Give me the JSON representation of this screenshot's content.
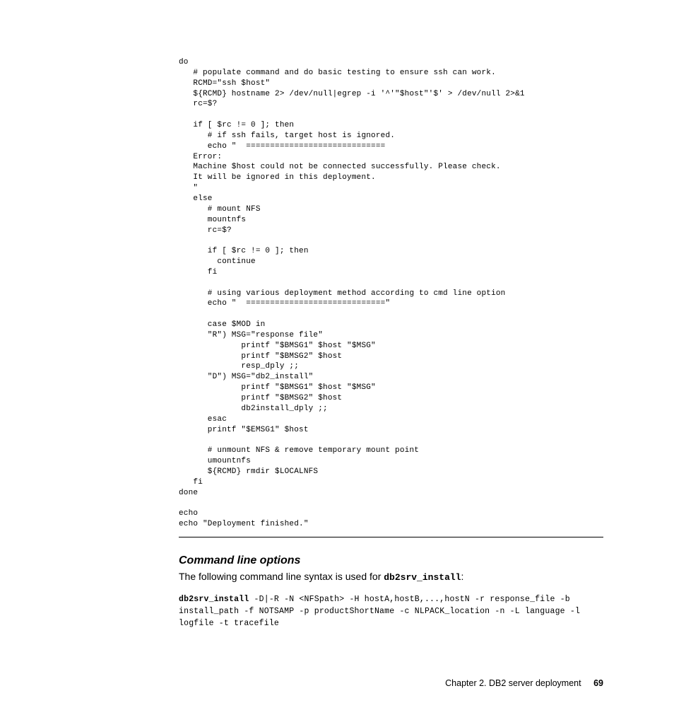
{
  "code_block": "do\n   # populate command and do basic testing to ensure ssh can work.\n   RCMD=\"ssh $host\"\n   ${RCMD} hostname 2> /dev/null|egrep -i '^'\"$host\"'$' > /dev/null 2>&1\n   rc=$?\n\n   if [ $rc != 0 ]; then\n      # if ssh fails, target host is ignored.\n      echo \"  =============================\n   Error:\n   Machine $host could not be connected successfully. Please check.\n   It will be ignored in this deployment.\n   \"\n   else\n      # mount NFS\n      mountnfs\n      rc=$?\n\n      if [ $rc != 0 ]; then\n        continue\n      fi\n\n      # using various deployment method according to cmd line option\n      echo \"  =============================\"\n\n      case $MOD in\n      \"R\") MSG=\"response file\"\n             printf \"$BMSG1\" $host \"$MSG\"\n             printf \"$BMSG2\" $host\n             resp_dply ;;\n      \"D\") MSG=\"db2_install\"\n             printf \"$BMSG1\" $host \"$MSG\"\n             printf \"$BMSG2\" $host\n             db2install_dply ;;\n      esac\n      printf \"$EMSG1\" $host\n\n      # unmount NFS & remove temporary mount point\n      umountnfs\n      ${RCMD} rmdir $LOCALNFS\n   fi\ndone\n\necho\necho \"Deployment finished.\"",
  "section": {
    "heading": "Command line options",
    "intro_prefix": "The following command line syntax is used for ",
    "intro_cmd": "db2srv_install",
    "intro_suffix": ":"
  },
  "syntax": {
    "cmd": "db2srv_install",
    "rest": " -D|-R -N <NFSpath> -H hostA,hostB,...,hostN -r response_file -b install_path -f NOTSAMP -p productShortName -c NLPACK_location -n -L language -l logfile -t tracefile"
  },
  "footer": {
    "chapter": "Chapter 2. DB2 server deployment",
    "page": "69"
  }
}
